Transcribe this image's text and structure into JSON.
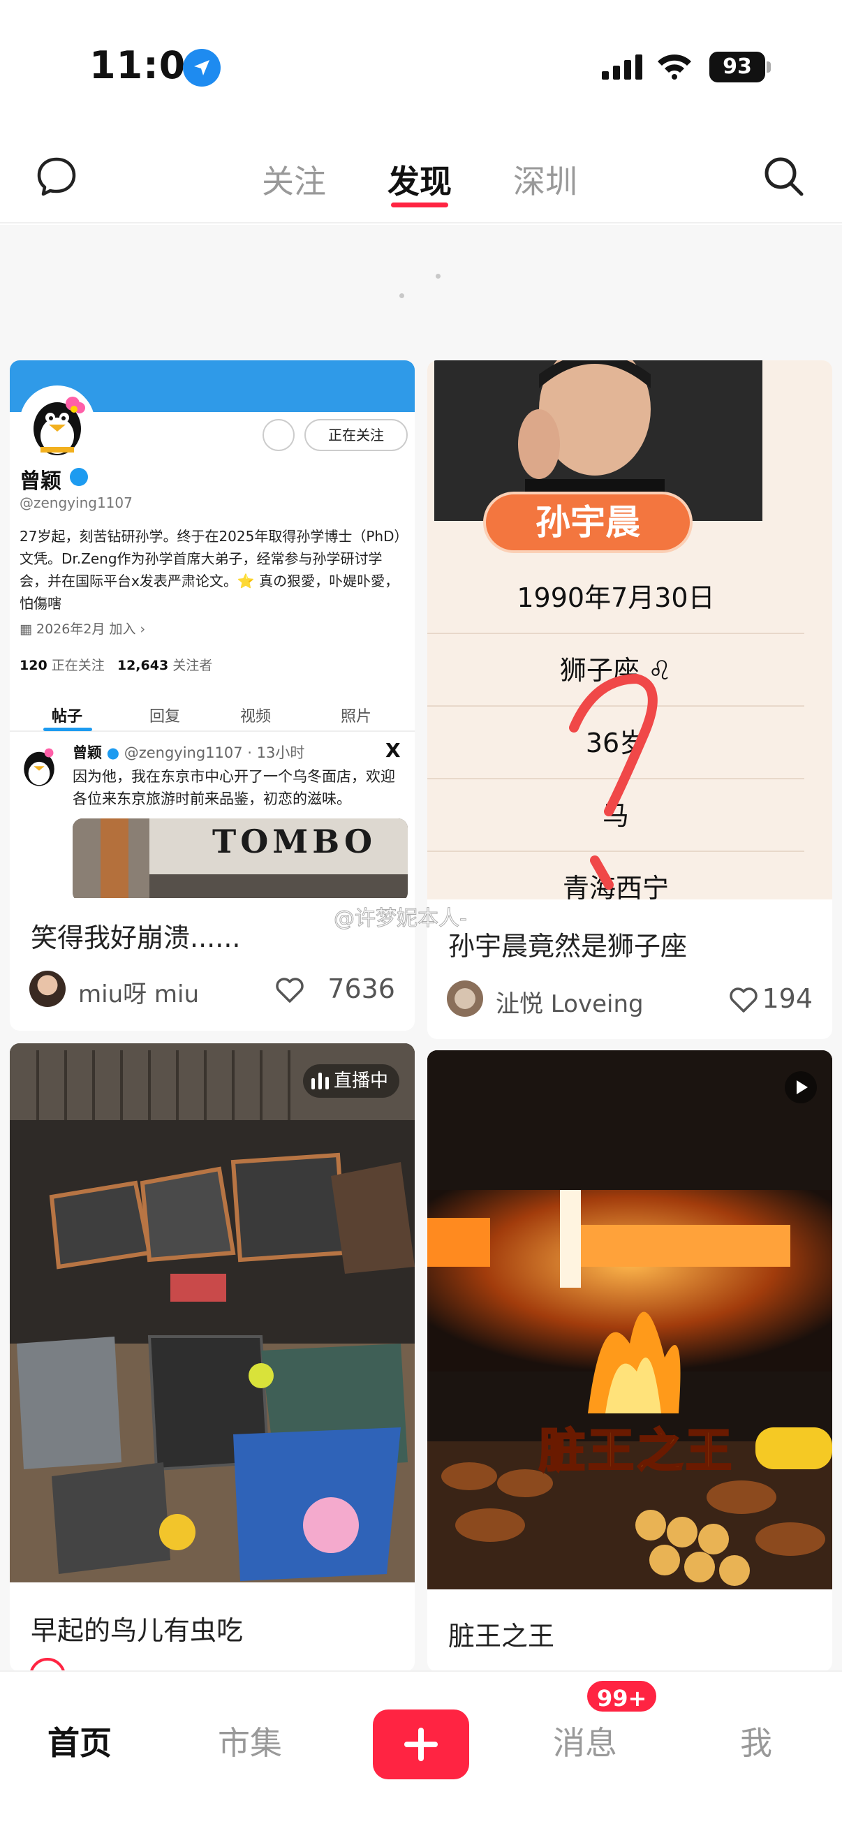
{
  "status_bar": {
    "time": "11:09",
    "battery": "93"
  },
  "header": {
    "tabs": [
      {
        "label": "关注",
        "active": false
      },
      {
        "label": "发现",
        "active": true
      },
      {
        "label": "深圳",
        "active": false
      }
    ],
    "accent_color": "#ff2442"
  },
  "feed": [
    {
      "title": "笑得我好崩溃......",
      "author": "miu呀 miu",
      "likes": "7636",
      "cover": {
        "kind": "tweet-screenshot",
        "follow_button": "正在关注",
        "name": "曾颖",
        "handle": "@zengying1107",
        "bio": "27岁起，刻苦钻研孙学。终于在2025年取得孙学博士（PhD）文凭。Dr.Zeng作为孙学首席大弟子，经常参与孙学研讨学会，并在国际平台x发表严肃论文。⭐ 真の狠愛，卟媞卟愛，怕傷嗐",
        "joined": "2026年2月 加入",
        "following_count": "120",
        "following_label": "正在关注",
        "followers_count": "12,643",
        "followers_label": "关注者",
        "tabs": [
          "帖子",
          "回复",
          "视频",
          "照片"
        ],
        "post_name": "曾颖",
        "post_meta": "@zengying1107 · 13小时",
        "post_text": "因为他，我在东京市中心开了一个乌冬面店，欢迎各位来东京旅游时前来品鉴，初恋的滋味。",
        "photo_sign": "TOMBO"
      }
    },
    {
      "title": "孙宇晨竟然是狮子座",
      "author": "沚悦 Loveing",
      "likes": "194",
      "cover": {
        "kind": "info-card",
        "name_tag": "孙宇晨",
        "rows": [
          "1990年7月30日",
          "狮子座 ♌",
          "36岁",
          "马",
          "青海西宁"
        ]
      }
    },
    {
      "title": "早起的鸟儿有虫吃",
      "author": "",
      "likes": "",
      "cover": {
        "kind": "photo",
        "badge": "直播中"
      }
    },
    {
      "title": "脏王之王",
      "author": "",
      "likes": "",
      "cover": {
        "kind": "video",
        "overlay_text": "脏王之王"
      }
    }
  ],
  "watermark": "@许梦妮本人-",
  "bottom_nav": {
    "home": "首页",
    "market": "市集",
    "messages": "消息",
    "messages_badge": "99+",
    "me": "我"
  }
}
